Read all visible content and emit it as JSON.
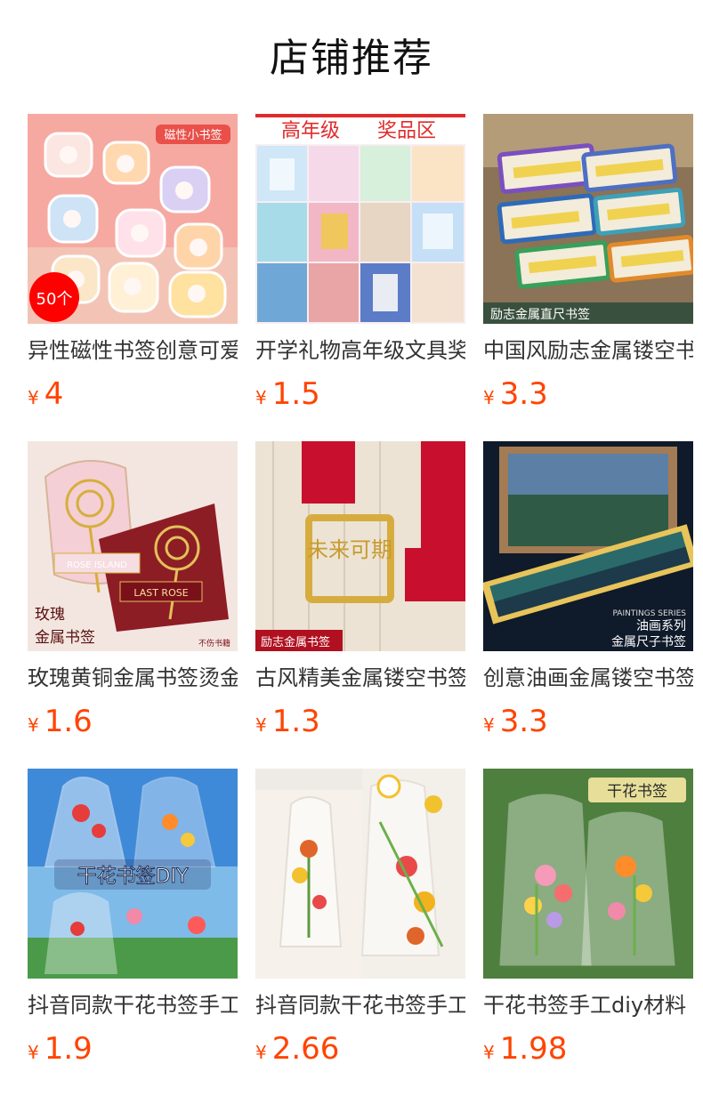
{
  "section": {
    "title": "店铺推荐"
  },
  "products": [
    {
      "name": "异性磁性书签创意可爱",
      "currency": "¥",
      "price": "4",
      "overlay": [
        "磁性小书签",
        "50个"
      ]
    },
    {
      "name": "开学礼物高年级文具奖品",
      "currency": "¥",
      "price": "1.5",
      "overlay": [
        "高年级",
        "奖品区"
      ]
    },
    {
      "name": "中国风励志金属镂空书签",
      "currency": "¥",
      "price": "3.3",
      "overlay": [
        "励志金属直尺书签"
      ]
    },
    {
      "name": "玫瑰黄铜金属书签烫金",
      "currency": "¥",
      "price": "1.6",
      "overlay": [
        "玫瑰",
        "金属书签",
        "ROSE ISLAND",
        "LAST ROSE",
        "不伤书籍"
      ]
    },
    {
      "name": "古风精美金属镂空书签",
      "currency": "¥",
      "price": "1.3",
      "overlay": [
        "励志金属书签",
        "未来可期"
      ]
    },
    {
      "name": "创意油画金属镂空书签",
      "currency": "¥",
      "price": "3.3",
      "overlay": [
        "油画系列",
        "金属尺子书签",
        "PAINTINGS SERIES"
      ]
    },
    {
      "name": "抖音同款干花书签手工",
      "currency": "¥",
      "price": "1.9",
      "overlay": [
        "干花书签DIY"
      ]
    },
    {
      "name": "抖音同款干花书签手工",
      "currency": "¥",
      "price": "2.66",
      "overlay": []
    },
    {
      "name": "干花书签手工diy材料",
      "currency": "¥",
      "price": "1.98",
      "overlay": [
        "干花书签"
      ]
    }
  ],
  "colors": {
    "price": "#ff4400",
    "title": "#111111",
    "name": "#333333"
  }
}
